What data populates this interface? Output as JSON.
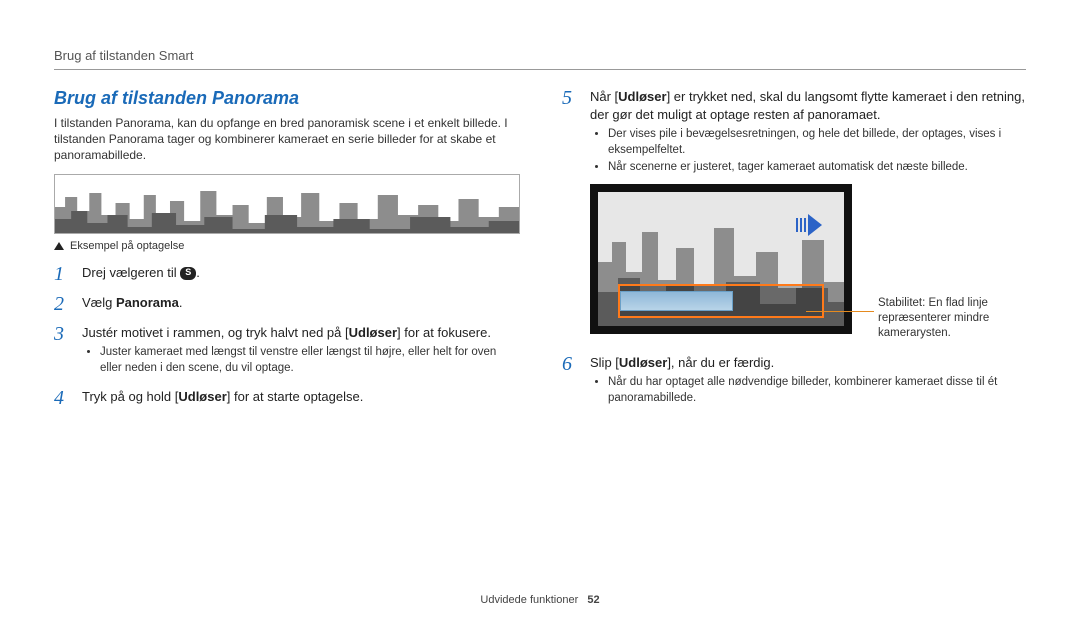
{
  "header": "Brug af tilstanden Smart",
  "section_title": "Brug af tilstanden Panorama",
  "intro_lines": [
    "I tilstanden Panorama, kan du opfange en bred panoramisk scene i et enkelt billede.",
    "I tilstanden Panorama tager og kombinerer kameraet en serie billeder for at skabe et panoramabillede."
  ],
  "caption": "Eksempel på optagelse",
  "dial_letter": "S",
  "left_steps": {
    "s1_pre": "Drej vælgeren til ",
    "s1_post": ".",
    "s2_pre": "Vælg ",
    "s2_bold": "Panorama",
    "s2_post": ".",
    "s3_pre": "Justér motivet i rammen, og tryk halvt ned på [",
    "s3_bold": "Udløser",
    "s3_post": "] for at fokusere.",
    "s3_sub": "Juster kameraet med længst til venstre eller længst til højre, eller helt for oven eller neden i den scene, du vil optage.",
    "s4_pre": "Tryk på og hold [",
    "s4_bold": "Udløser",
    "s4_post": "] for at starte optagelse."
  },
  "right_steps": {
    "s5_pre": "Når [",
    "s5_bold": "Udløser",
    "s5_post": "] er trykket ned, skal du langsomt flytte kameraet i den retning, der gør det muligt at optage resten af panoramaet.",
    "s5_sub1": "Der vises pile i bevægelsesretningen, og hele det billede, der optages, vises i eksempelfeltet.",
    "s5_sub2": "Når scenerne er justeret, tager kameraet automatisk det næste billede.",
    "s6_pre": "Slip [",
    "s6_bold": "Udløser",
    "s6_post": "], når du er færdig.",
    "s6_sub": "Når du har optaget alle nødvendige billeder, kombinerer kameraet disse til ét panoramabillede."
  },
  "callout_text": "Stabilitet: En flad linje repræsenterer mindre kamerarysten.",
  "footer_label": "Udvidede funktioner",
  "footer_page": "52"
}
